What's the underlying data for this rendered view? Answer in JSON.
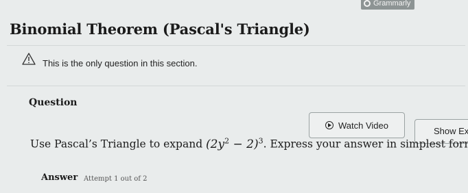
{
  "extension": {
    "name": "Grammarly"
  },
  "page": {
    "title": "Binomial Theorem (Pascal's Triangle)"
  },
  "notice": {
    "icon": "warning-icon",
    "text": "This is the only question in this section."
  },
  "question": {
    "label": "Question",
    "prefix": "Use Pascal’s Triangle to expand ",
    "expr_open": "(2",
    "expr_var": "y",
    "expr_exp": "2",
    "expr_mid": " − 2)",
    "expr_power": "3",
    "suffix": ". Express your answer in simplest form."
  },
  "buttons": {
    "watch_video": "Watch Video",
    "show_example": "Show Ex"
  },
  "answer": {
    "label": "Answer",
    "attempt": "Attempt 1 out of 2"
  }
}
